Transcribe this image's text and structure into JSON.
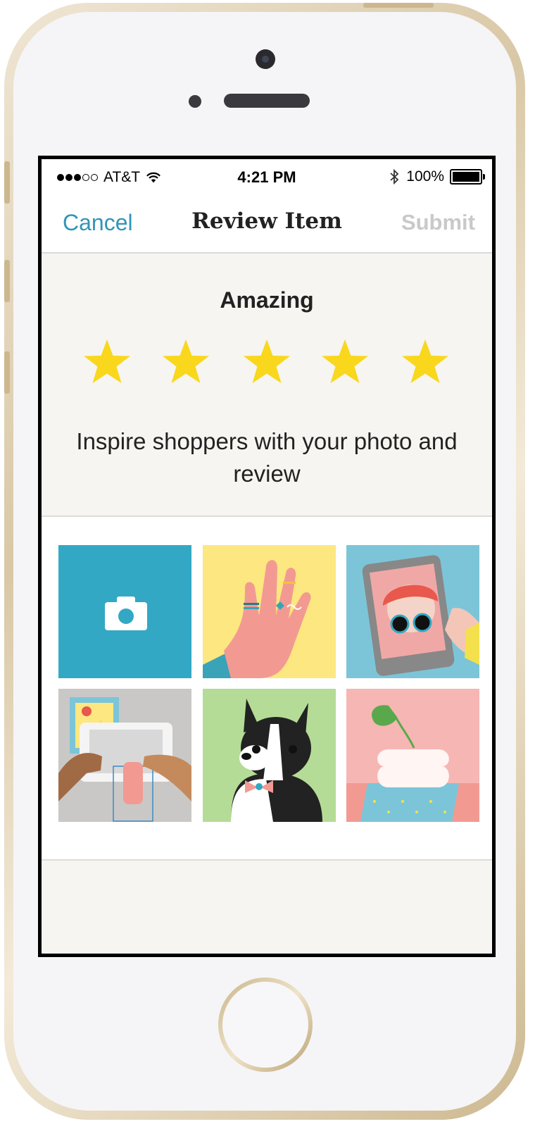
{
  "status_bar": {
    "carrier": "AT&T",
    "time": "4:21 PM",
    "bluetooth_icon": "bluetooth-icon",
    "battery": "100%"
  },
  "navbar": {
    "cancel_label": "Cancel",
    "title": "Review Item",
    "submit_label": "Submit"
  },
  "rating": {
    "label": "Amazing",
    "stars": 5,
    "max_stars": 5,
    "star_color": "#f9d71c"
  },
  "prompt": "Inspire shoppers with your photo and review",
  "photos": [
    {
      "name": "camera",
      "icon": "camera-icon",
      "color": "#33a8c4"
    },
    {
      "name": "hand-with-rings",
      "color": "#fde780"
    },
    {
      "name": "selfie-phone",
      "color": "#7cc5d8"
    },
    {
      "name": "hands-holding-photo",
      "color": "#c9c8c6"
    },
    {
      "name": "boston-terrier",
      "color": "#b4dc96"
    },
    {
      "name": "vase-with-plant",
      "color": "#f6b6b4"
    }
  ],
  "colors": {
    "accent": "#3195b6",
    "disabled": "#c9c9c9",
    "background": "#f6f5f1"
  }
}
